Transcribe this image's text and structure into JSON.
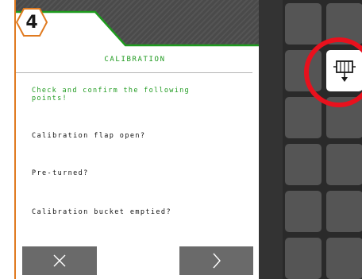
{
  "step": {
    "number": "4"
  },
  "dialog": {
    "title": "CALIBRATION",
    "instruction": "Check and confirm the following points!",
    "checks": [
      "Calibration flap open?",
      "Pre-turned?",
      "Calibration bucket emptied?"
    ]
  },
  "buttons": {
    "cancel_icon": "close-icon",
    "next_icon": "chevron-right-icon"
  },
  "softkeys": {
    "highlighted_icon": "calibration-bucket-down-icon"
  },
  "colors": {
    "accent_green": "#1e9a1e",
    "badge_orange": "#e07a1f",
    "highlight_red": "#e8111d",
    "button_gray": "#6a6a6a",
    "softkey_gray": "#555555"
  }
}
